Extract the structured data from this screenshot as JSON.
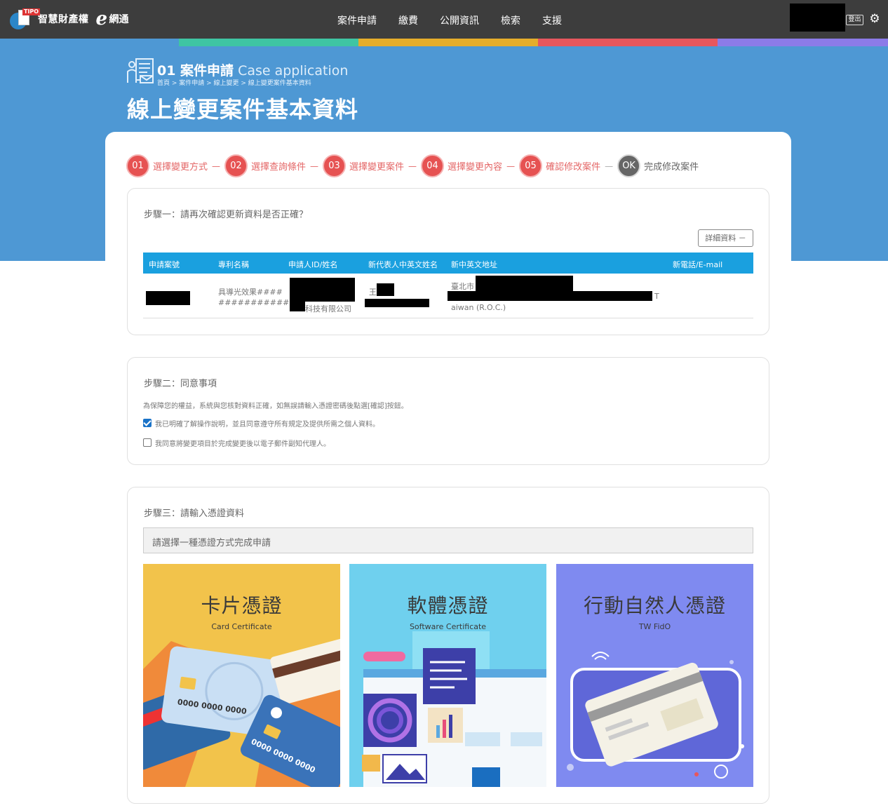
{
  "header": {
    "brand_name": "智慧財產權",
    "brand_e": "e",
    "brand_suffix": "網通",
    "logo_tag": "TIPO",
    "nav": [
      "案件申請",
      "繳費",
      "公開資訊",
      "檢索",
      "支援"
    ],
    "logout_label": "登出"
  },
  "colors": {
    "topbar": "#3d3d3d",
    "hero": "#4e98d4",
    "strip": [
      "#3fc5a3",
      "#e5ad2b",
      "#e7575d",
      "#8c7be8"
    ],
    "step_active": "#e65252",
    "table_header": "#1aa0df"
  },
  "hero": {
    "section_title": "01 案件申請",
    "section_title_en": "Case application",
    "breadcrumb": "首頁 > 案件申請 > 線上變更 > 線上變更案件基本資料",
    "page_title": "線上變更案件基本資料"
  },
  "steps": [
    {
      "num": "01",
      "label": "選擇變更方式"
    },
    {
      "num": "02",
      "label": "選擇查詢條件"
    },
    {
      "num": "03",
      "label": "選擇變更案件"
    },
    {
      "num": "04",
      "label": "選擇變更內容"
    },
    {
      "num": "05",
      "label": "確認修改案件"
    },
    {
      "num": "OK",
      "label": "完成修改案件"
    }
  ],
  "step_one": {
    "title": "步驟一：請再次確認更新資料是否正確？",
    "detail_button": "詳細資料 －",
    "columns": [
      "申請案號",
      "專利名稱",
      "申請人ID/姓名",
      "新代表人中英文姓名",
      "新中英文地址",
      "新電話/E-mail"
    ],
    "row": {
      "patent_name_1": "具導光效果####",
      "patent_name_2": "###########",
      "applicant_suffix": "科技有限公司",
      "rep_prefix": "王",
      "addr_prefix": "臺北市",
      "addr_tail": "T",
      "addr_line2": "aiwan (R.O.C.)"
    }
  },
  "step_two": {
    "title": "步驟二：同意事項",
    "note": "為保障您的權益，系統與您核對資料正確，如無誤請輸入憑證密碼後點選[確認]按鈕。",
    "agree_1": "我已明確了解操作說明，並且同意遵守所有規定及提供所需之個人資料。",
    "agree_1_checked": true,
    "agree_2": "我同意將變更項目於完成變更後以電子郵件副知代理人。",
    "agree_2_checked": false
  },
  "step_three": {
    "title": "步驟三：請輸入憑證資料",
    "select_text": "請選擇一種憑證方式完成申請",
    "options": [
      {
        "title": "卡片憑證",
        "subtitle": "Card Certificate",
        "bg": "#f2c34b"
      },
      {
        "title": "軟體憑證",
        "subtitle": "Software Certificate",
        "bg": "#6fd0ee"
      },
      {
        "title": "行動自然人憑證",
        "subtitle": "TW FidO",
        "bg": "#7f8af0"
      }
    ]
  }
}
